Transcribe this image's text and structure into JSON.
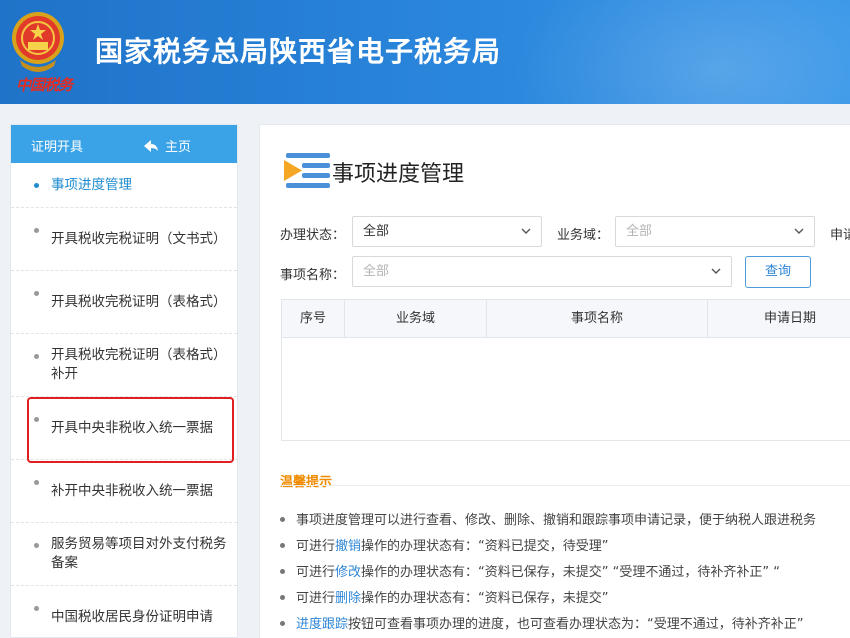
{
  "header": {
    "title": "国家税务总局陕西省电子税务局",
    "emblem_text": "中国税务"
  },
  "sidebar": {
    "tab_label": "证明开具",
    "home_label": "主页",
    "items": [
      {
        "label": "事项进度管理"
      },
      {
        "label": "开具税收完税证明（文书式）"
      },
      {
        "label": "开具税收完税证明（表格式）"
      },
      {
        "label": "开具税收完税证明（表格式）补开"
      },
      {
        "label": "开具中央非税收入统一票据"
      },
      {
        "label": "补开中央非税收入统一票据"
      },
      {
        "label": "服务贸易等项目对外支付税务备案"
      },
      {
        "label": "中国税收居民身份证明申请"
      }
    ]
  },
  "main": {
    "title": "事项进度管理",
    "filters": {
      "status_label": "办理状态：",
      "status_value": "全部",
      "domain_label": "业务域：",
      "domain_placeholder": "全部",
      "apply_label": "申请",
      "item_label": "事项名称：",
      "item_placeholder": "全部",
      "query_button": "查询"
    },
    "table": {
      "columns": [
        "序号",
        "业务域",
        "事项名称",
        "申请日期"
      ]
    },
    "tips": {
      "title": "温馨提示",
      "lines": [
        {
          "pre": "",
          "link": "",
          "post": "事项进度管理可以进行查看、修改、删除、撤销和跟踪事项申请记录，便于纳税人跟进税务"
        },
        {
          "pre": "可进行",
          "link": "撤销",
          "post": "操作的办理状态有：“资料已提交，待受理”"
        },
        {
          "pre": "可进行",
          "link": "修改",
          "post": "操作的办理状态有：“资料已保存，未提交”  “受理不通过，待补齐补正”  “"
        },
        {
          "pre": "可进行",
          "link": "删除",
          "post": "操作的办理状态有：“资料已保存，未提交”"
        },
        {
          "pre": "",
          "link": "进度跟踪",
          "post": "按钮可查看事项办理的进度，也可查看办理状态为：“受理不通过，待补齐补正”"
        }
      ]
    }
  },
  "colors": {
    "header_blue": "#2a86dc",
    "sidebar_head": "#3aa3e8",
    "link_blue": "#2f86d6",
    "tips_orange": "#f08a00",
    "highlight_red": "#e02020"
  }
}
